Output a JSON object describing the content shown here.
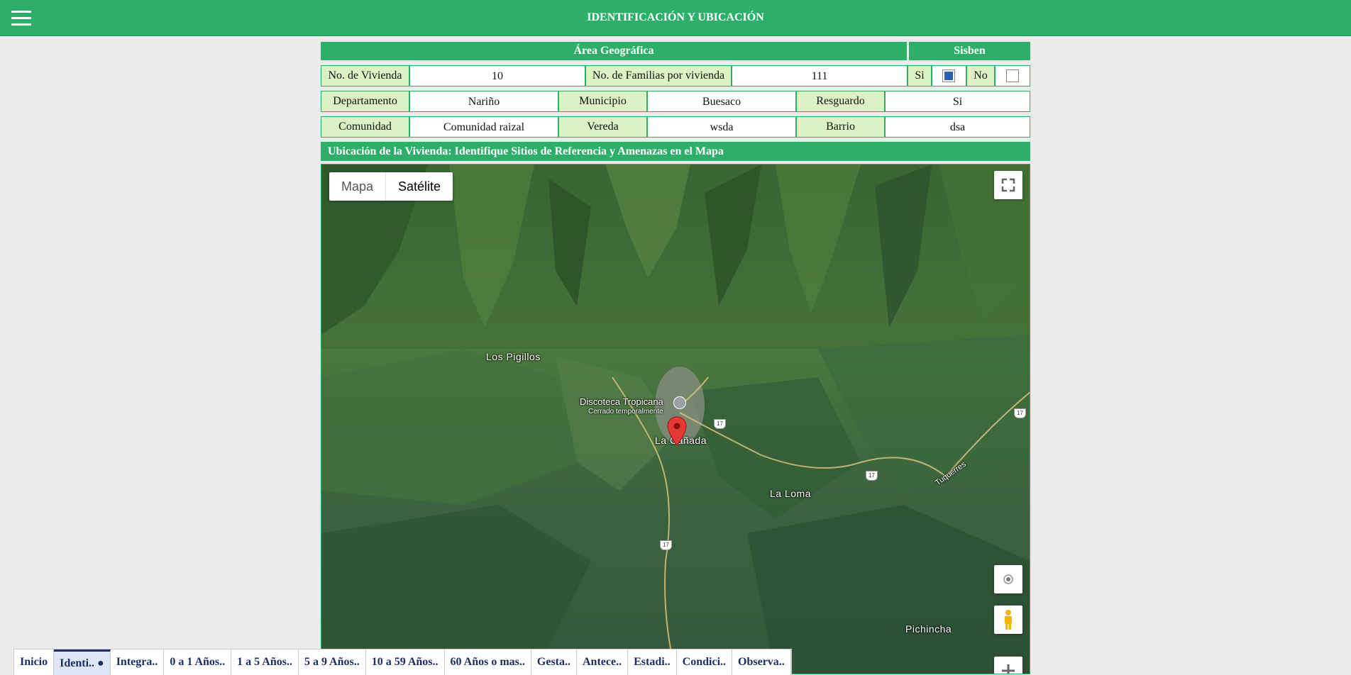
{
  "header": {
    "title": "IDENTIFICACIÓN Y UBICACIÓN",
    "menu_icon": "hamburger-menu-icon"
  },
  "form": {
    "area_header": "Área Geográfica",
    "sisben_header": "Sisben",
    "row1": {
      "vivienda_label": "No. de Vivienda",
      "vivienda_value": "10",
      "familias_label": "No. de Familias por vivienda",
      "familias_value": "111",
      "si_label": "Si",
      "si_checked": true,
      "no_label": "No",
      "no_checked": false
    },
    "row2": {
      "departamento_label": "Departamento",
      "departamento_value": "Nariño",
      "municipio_label": "Municipio",
      "municipio_value": "Buesaco",
      "resguardo_label": "Resguardo",
      "resguardo_value": "Si"
    },
    "row3": {
      "comunidad_label": "Comunidad",
      "comunidad_value": "Comunidad raizal",
      "vereda_label": "Vereda",
      "vereda_value": "wsda",
      "barrio_label": "Barrio",
      "barrio_value": "dsa"
    }
  },
  "map_section": {
    "title": "Ubicación de la Vivienda: Identifique Sitios de Referencia y Amenazas en el Mapa"
  },
  "map": {
    "type_map": "Mapa",
    "type_satellite": "Satélite",
    "selected_type": "Satélite",
    "places": {
      "los_pigillos": "Los Pigillos",
      "discoteca": "Discoteca Tropicana",
      "discoteca_status": "Cerrado temporalmente",
      "la_canada": "La Cañada",
      "la_loma": "La Loma",
      "pichincha": "Pichincha",
      "tuquerres": "Tuquerres"
    },
    "route_number": "17",
    "marker_color": "#e53935"
  },
  "tabs": [
    "Inicio",
    "Identi.. ●",
    "Integra..",
    "0 a 1 Años..",
    "1 a 5 Años..",
    "5 a 9 Años..",
    "10 a 59 Años..",
    "60 Años o mas..",
    "Gesta..",
    "Antece..",
    "Estadi..",
    "Condici..",
    "Observa.."
  ],
  "active_tab": "Identi.. ●",
  "colors": {
    "primary": "#2daf6a",
    "label_bg": "#dcf2c4",
    "tab_text": "#1c2f63"
  }
}
